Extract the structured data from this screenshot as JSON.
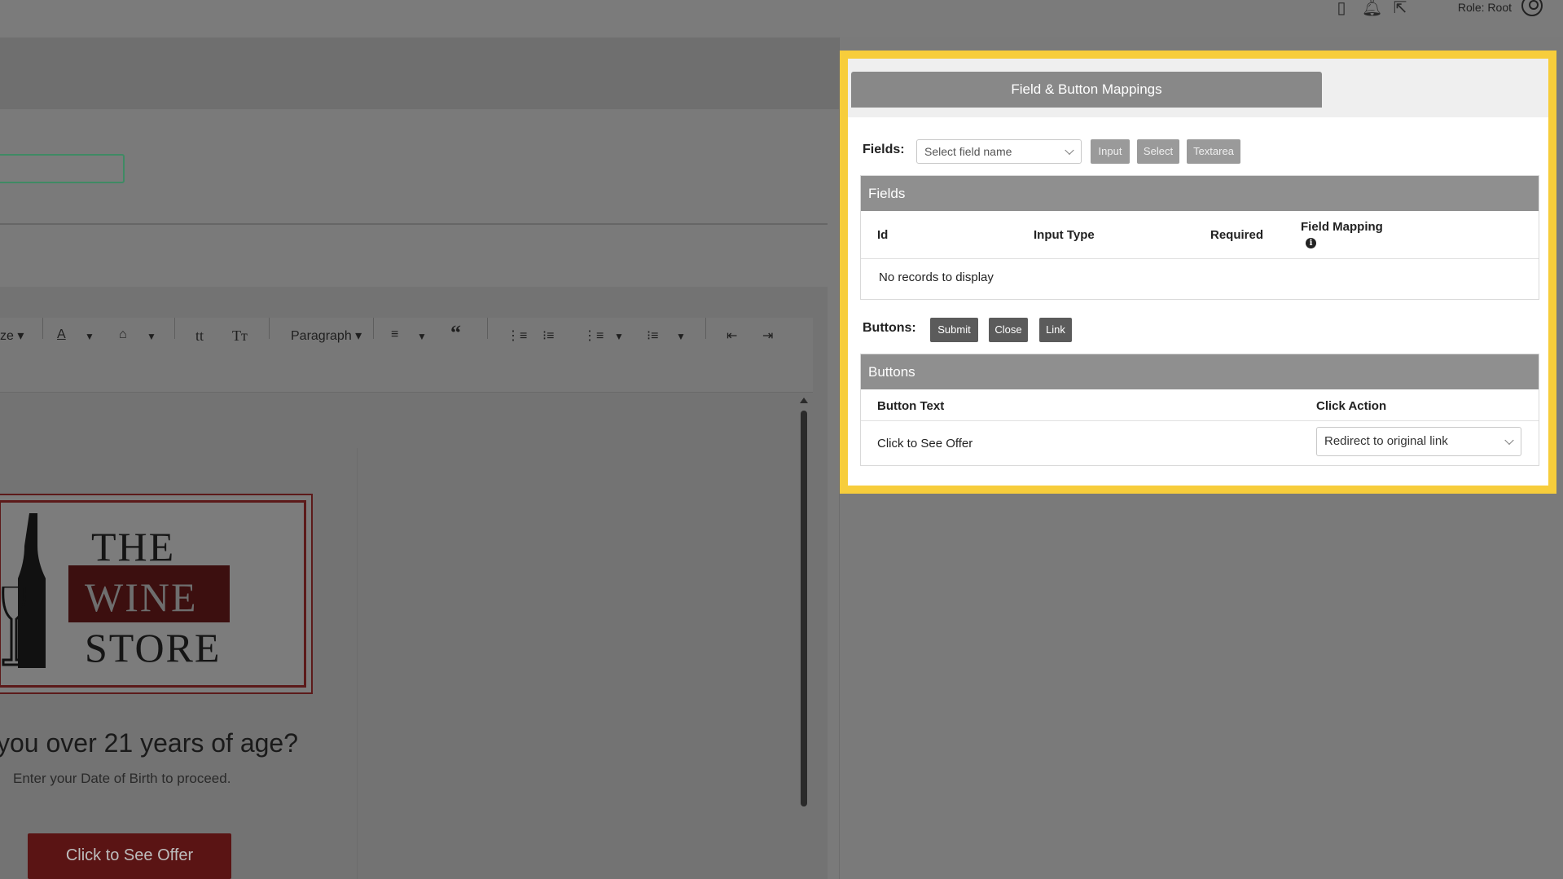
{
  "header": {
    "icons": [
      "phone-icon",
      "bell-icon",
      "exit-icon"
    ],
    "user_role": "Role: Root"
  },
  "editor": {
    "toolbar": {
      "font_size_fragment": "ze",
      "paragraph_label": "Paragraph"
    },
    "logo": {
      "line1": "THE",
      "line2": "WINE",
      "line3": "STORE"
    },
    "heading_fragment": "you over 21 years of age?",
    "subtext": "Enter your Date of Birth to proceed.",
    "cta_label": "Click to See Offer"
  },
  "panel": {
    "tab_title": "Field & Button Mappings",
    "fields_row": {
      "label": "Fields:",
      "select_placeholder": "Select field name",
      "chips": [
        "Input",
        "Select",
        "Textarea"
      ]
    },
    "fields_grid": {
      "title": "Fields",
      "columns": [
        "Id",
        "Input Type",
        "Required",
        "Field Mapping"
      ],
      "empty_message": "No records to display"
    },
    "buttons_row": {
      "label": "Buttons:",
      "chips": [
        "Submit",
        "Close",
        "Link"
      ]
    },
    "buttons_grid": {
      "title": "Buttons",
      "columns": [
        "Button Text",
        "Click Action"
      ],
      "rows": [
        {
          "button_text": "Click to See Offer",
          "click_action": "Redirect to original link"
        }
      ]
    }
  },
  "colors": {
    "highlight_border": "#f7cd3b",
    "grid_header": "#8f8f8f",
    "chip_dark": "#5b5b5b",
    "chip_light": "#9a9a9a",
    "cta_bg": "#5a1414"
  }
}
